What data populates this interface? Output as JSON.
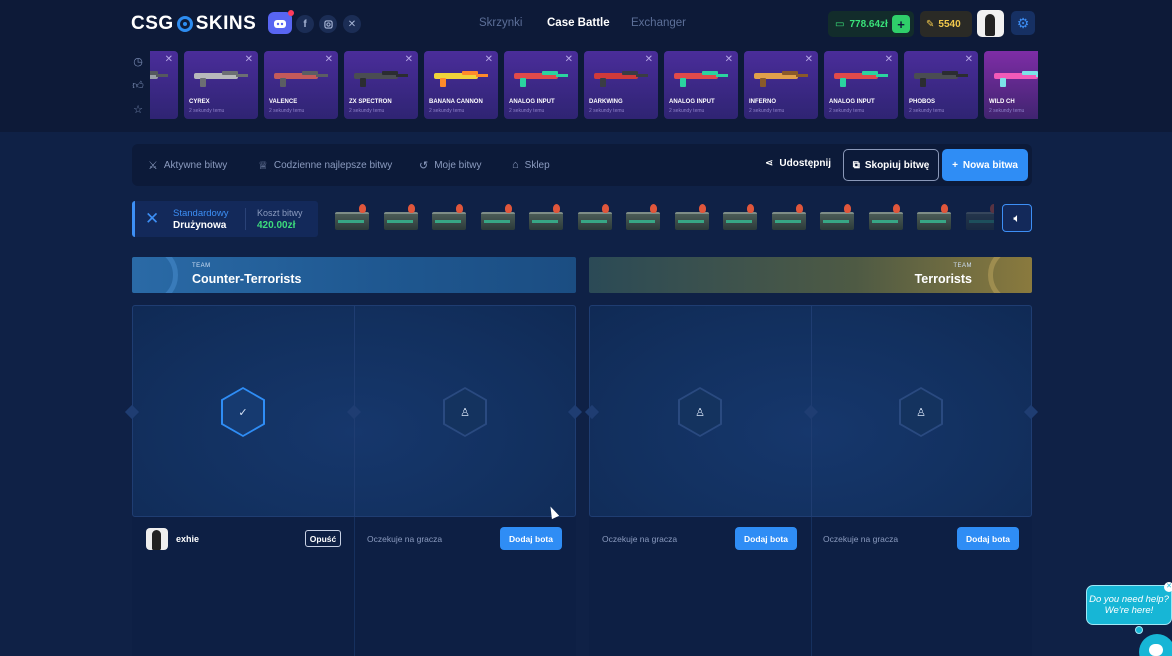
{
  "header": {
    "logo_left": "CSG",
    "logo_right": "SKINS",
    "social": [
      "discord-icon",
      "facebook-icon",
      "instagram-icon",
      "x-icon"
    ],
    "nav": [
      {
        "label": "Skrzynki",
        "active": false
      },
      {
        "label": "Case Battle",
        "active": true
      },
      {
        "label": "Exchanger",
        "active": false
      }
    ],
    "balance": "778.64zł",
    "coins": "5540",
    "accent": "#2f8df5",
    "balance_color": "#39e27a",
    "coins_color": "#f2c94c"
  },
  "live_drops": {
    "side_icons": [
      "clock-icon",
      "thumb-up-icon",
      "star-icon"
    ],
    "items": [
      {
        "name": "OR",
        "sub": "... ...",
        "variant": "purple",
        "gun": "pistol-gray"
      },
      {
        "name": "CYREX",
        "sub": "2 sekundy temu",
        "variant": "purple",
        "gun": "smg-gray"
      },
      {
        "name": "VALENCE",
        "sub": "2 sekundy temu",
        "variant": "purple",
        "gun": "smg-red"
      },
      {
        "name": "ZX SPECTRON",
        "sub": "2 sekundy temu",
        "variant": "purple",
        "gun": "rifle-dark"
      },
      {
        "name": "BANANA CANNON",
        "sub": "2 sekundy temu",
        "variant": "purple",
        "gun": "revolver-yellow"
      },
      {
        "name": "ANALOG INPUT",
        "sub": "2 sekundy temu",
        "variant": "purple",
        "gun": "shotgun-rainbow"
      },
      {
        "name": "DARKWING",
        "sub": "2 sekundy temu",
        "variant": "purple",
        "gun": "shotgun-red"
      },
      {
        "name": "ANALOG INPUT",
        "sub": "2 sekundy temu",
        "variant": "purple",
        "gun": "shotgun-rainbow"
      },
      {
        "name": "INFERNO",
        "sub": "2 sekundy temu",
        "variant": "purple",
        "gun": "pistol-orange"
      },
      {
        "name": "ANALOG INPUT",
        "sub": "2 sekundy temu",
        "variant": "purple",
        "gun": "shotgun-rainbow"
      },
      {
        "name": "PHOBOS",
        "sub": "2 sekundy temu",
        "variant": "purple",
        "gun": "rifle-dark"
      },
      {
        "name": "WILD CH",
        "sub": "2 sekundy temu",
        "variant": "pink",
        "gun": "knife-pink"
      }
    ]
  },
  "toolbar": {
    "items": [
      {
        "icon": "swords-icon",
        "label": "Aktywne bitwy"
      },
      {
        "icon": "trophy-icon",
        "label": "Codzienne najlepsze bitwy"
      },
      {
        "icon": "history-icon",
        "label": "Moje bitwy"
      },
      {
        "icon": "shop-icon",
        "label": "Sklep"
      }
    ],
    "share_label": "Udostępnij",
    "copy_label": "Skopiuj bitwę",
    "new_label": "Nowa bitwa"
  },
  "battle": {
    "mode": "Standardowy",
    "mode_sub": "Drużynowa",
    "cost_label": "Koszt bitwy",
    "cost_value": "420.00zł",
    "case_count": 14
  },
  "teams": {
    "small_label": "TEAM",
    "ct_name": "Counter-Terrorists",
    "t_name": "Terrorists",
    "ct_color": "#2a6aa6",
    "t_color": "#8a7a3e"
  },
  "slots": {
    "player_name": "exhie",
    "leave_label": "Opuść",
    "waiting_label": "Oczekuje na gracza",
    "add_bot_label": "Dodaj bota"
  },
  "help": {
    "line1": "Do you need help?",
    "line2": "We're here!"
  }
}
